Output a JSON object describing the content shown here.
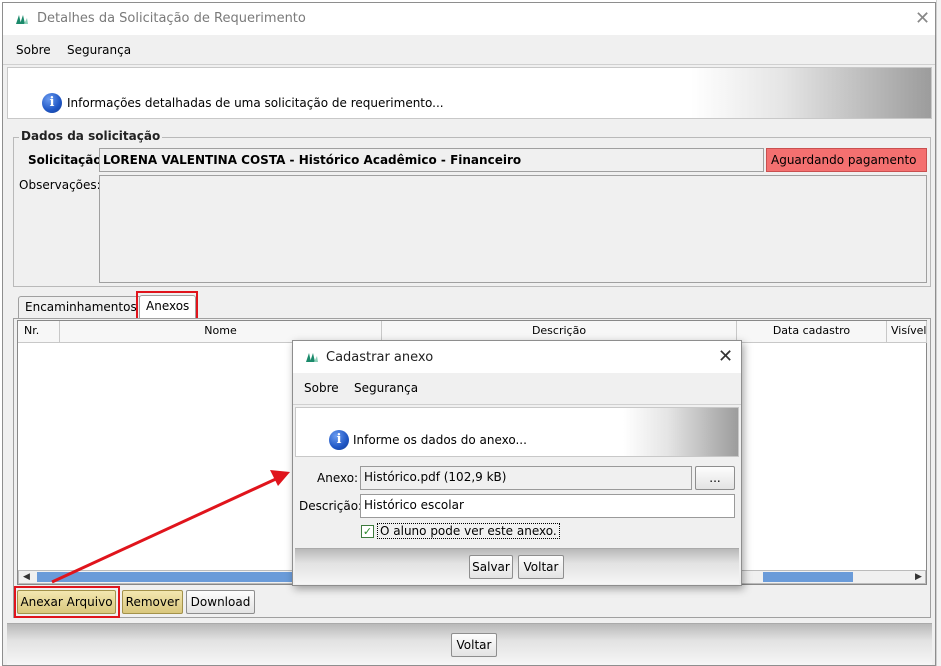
{
  "main_window": {
    "title": "Detalhes da Solicitação de Requerimento",
    "menu": {
      "sobre": "Sobre",
      "seguranca": "Segurança"
    },
    "info_text": "Informações detalhadas de uma solicitação de requerimento...",
    "dados": {
      "legend": "Dados da solicitação",
      "solicitacao_label": "Solicitação:",
      "solicitacao_value": "LORENA VALENTINA COSTA - Histórico Acadêmico - Financeiro",
      "status": "Aguardando pagamento",
      "observacoes_label": "Observações:"
    },
    "tabs": [
      {
        "label": "Encaminhamentos"
      },
      {
        "label": "Anexos"
      }
    ],
    "table": {
      "columns": [
        "Nr.",
        "Nome",
        "Descrição",
        "Data cadastro",
        "Visível"
      ]
    },
    "buttons": {
      "anexar": "Anexar Arquivo",
      "remover": "Remover",
      "download": "Download",
      "voltar": "Voltar"
    }
  },
  "dialog": {
    "title": "Cadastrar anexo",
    "menu": {
      "sobre": "Sobre",
      "seguranca": "Segurança"
    },
    "info_text": "Informe os dados do anexo...",
    "anexo_label": "Anexo:",
    "anexo_value": "Histórico.pdf (102,9 kB)",
    "browse_label": "...",
    "descricao_label": "Descrição:",
    "descricao_value": "Histórico escolar",
    "checkbox_label": "O aluno pode ver este anexo.",
    "checkbox_checked": true,
    "buttons": {
      "salvar": "Salvar",
      "voltar": "Voltar"
    }
  },
  "colors": {
    "status_bg": "#f47070",
    "highlight_red": "#e0141c",
    "accent_button": "#d9c77d",
    "scroll_blue": "#6a9bd9"
  }
}
